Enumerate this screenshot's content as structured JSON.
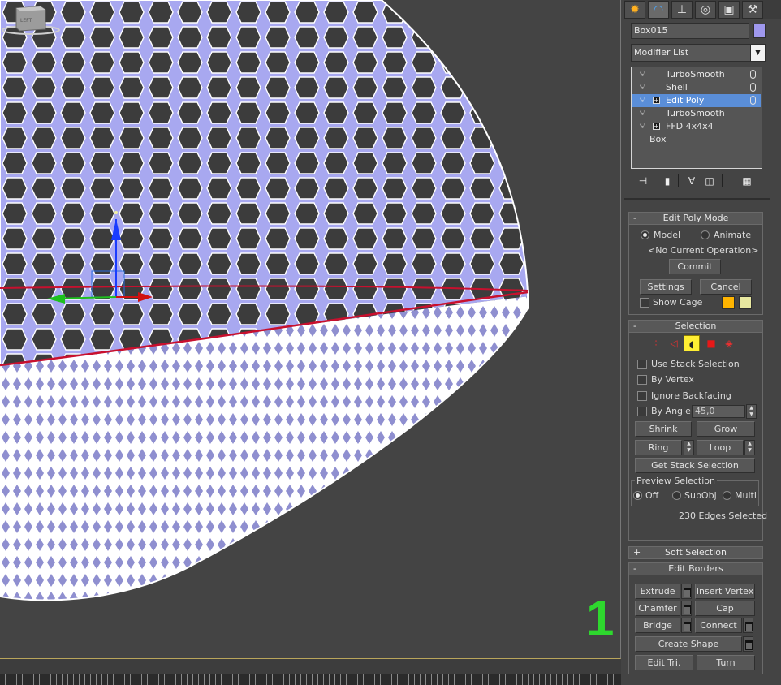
{
  "object": {
    "name": "Box015",
    "color": "#9f98ee"
  },
  "modifier_list": {
    "label": "Modifier List"
  },
  "stack": {
    "items": [
      {
        "label": "TurboSmooth",
        "expandable": false,
        "pinned": true,
        "selected": false
      },
      {
        "label": "Shell",
        "expandable": false,
        "pinned": true,
        "selected": false
      },
      {
        "label": "Edit Poly",
        "expandable": true,
        "pinned": true,
        "selected": true
      },
      {
        "label": "TurboSmooth",
        "expandable": false,
        "pinned": false,
        "selected": false
      },
      {
        "label": "FFD 4x4x4",
        "expandable": true,
        "pinned": false,
        "selected": false
      }
    ],
    "base": "Box"
  },
  "edit_poly_mode": {
    "title": "Edit Poly Mode",
    "model": "Model",
    "animate": "Animate",
    "status": "<No Current Operation>",
    "commit": "Commit",
    "settings": "Settings",
    "cancel": "Cancel",
    "show_cage": "Show Cage",
    "cage_colors": [
      "#ffb400",
      "#e8e8a0"
    ]
  },
  "selection": {
    "title": "Selection",
    "use_stack_selection": "Use Stack Selection",
    "by_vertex": "By Vertex",
    "ignore_backfacing": "Ignore Backfacing",
    "by_angle": "By Angle:",
    "angle_value": "45,0",
    "shrink": "Shrink",
    "grow": "Grow",
    "ring": "Ring",
    "loop": "Loop",
    "get_stack_selection": "Get Stack Selection",
    "preview_title": "Preview Selection",
    "preview_off": "Off",
    "preview_subobj": "SubObj",
    "preview_multi": "Multi",
    "status": "230 Edges Selected",
    "active_level": "border"
  },
  "soft_selection": {
    "title": "Soft Selection"
  },
  "edit_borders": {
    "title": "Edit Borders",
    "extrude": "Extrude",
    "insert_vertex": "Insert Vertex",
    "chamfer": "Chamfer",
    "cap": "Cap",
    "bridge": "Bridge",
    "connect": "Connect",
    "create_shape": "Create Shape",
    "edit_tri": "Edit Tri.",
    "turn": "Turn"
  },
  "annotation": {
    "step": "1",
    "color": "#2ed82e"
  },
  "viewcube": {
    "face": "LEFT"
  },
  "icons": {
    "tabs": [
      "create-icon",
      "modify-icon",
      "hierarchy-icon",
      "motion-icon",
      "display-icon",
      "utilities-icon"
    ],
    "selection_levels": [
      "vertex-icon",
      "edge-icon",
      "border-icon",
      "polygon-icon",
      "element-icon"
    ]
  }
}
